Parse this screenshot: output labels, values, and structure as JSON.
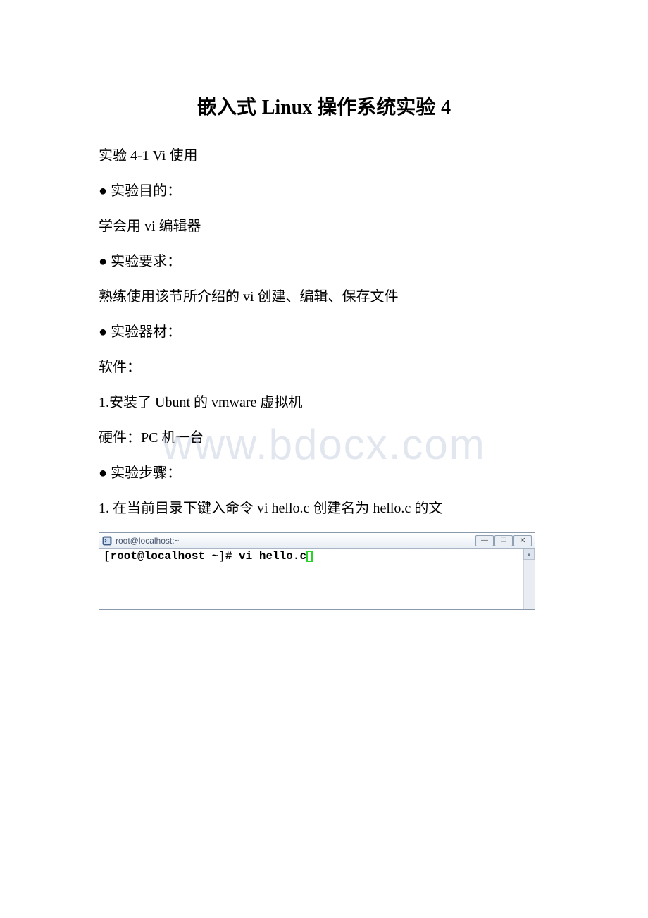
{
  "title": {
    "prefix": "嵌入式 ",
    "latin1": "Linux ",
    "middle": "操作系统实验 ",
    "num": "4"
  },
  "paragraphs": {
    "p1_a": "实验 ",
    "p1_b": "4-1 Vi ",
    "p1_c": "使用",
    "p2": "● 实验目的：",
    "p3_a": "学会用 ",
    "p3_b": "vi ",
    "p3_c": "编辑器",
    "p4": "● 实验要求：",
    "p5_a": "熟练使用该节所介绍的 ",
    "p5_b": "vi ",
    "p5_c": "创建、编辑、保存文件",
    "p6": "● 实验器材：",
    "p7": "软件：",
    "p8_a": "1.",
    "p8_b": "安装了 ",
    "p8_c": "Ubunt ",
    "p8_d": "的 ",
    "p8_e": "vmware ",
    "p8_f": "虚拟机",
    "p9_a": "硬件：",
    "p9_b": "PC ",
    "p9_c": "机一台",
    "p10": "● 实验步骤：",
    "p11_a": "1. ",
    "p11_b": "在当前目录下键入命令 ",
    "p11_c": "vi hello.c ",
    "p11_d": "创建名为 ",
    "p11_e": "hello.c ",
    "p11_f": "的文"
  },
  "terminal": {
    "title": "root@localhost:~",
    "prompt": "[root@localhost ~]# vi hello.c",
    "minimize": "—",
    "maximize": "❐",
    "close": "✕",
    "scroll_up": "▴"
  },
  "watermark": "www.bdocx.com"
}
